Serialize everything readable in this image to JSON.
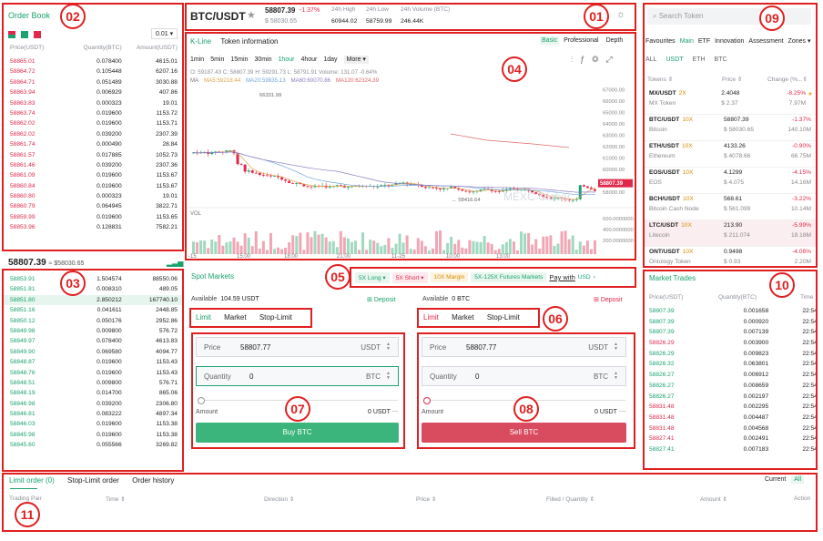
{
  "header": {
    "pair": "BTC/USDT",
    "price": "58807.39",
    "change": "-1.37%",
    "sub_price": "$ 58030.65",
    "stats": [
      {
        "label": "24h High",
        "value": "60944.02"
      },
      {
        "label": "24h Low",
        "value": "58759.99"
      },
      {
        "label": "24h Volume (BTC)",
        "value": "246.44K"
      }
    ]
  },
  "order_book": {
    "title": "Order Book",
    "precision": "0.01",
    "columns": [
      "Price(USDT)",
      "Quantity(BTC)",
      "Amount(USDT)"
    ],
    "asks": [
      [
        "58865.01",
        "0.078400",
        "4615.01"
      ],
      [
        "58864.72",
        "0.105448",
        "6207.16"
      ],
      [
        "58864.71",
        "0.051489",
        "3030.88"
      ],
      [
        "58863.94",
        "0.006929",
        "407.86"
      ],
      [
        "58863.83",
        "0.000323",
        "19.01"
      ],
      [
        "58863.74",
        "0.019600",
        "1153.72"
      ],
      [
        "58862.02",
        "0.019600",
        "1153.71"
      ],
      [
        "58862.02",
        "0.039200",
        "2307.39"
      ],
      [
        "58861.74",
        "0.000490",
        "28.84"
      ],
      [
        "58861.57",
        "0.017885",
        "1052.73"
      ],
      [
        "58861.46",
        "0.039200",
        "2307.36"
      ],
      [
        "58861.09",
        "0.019600",
        "1153.67"
      ],
      [
        "58860.84",
        "0.019600",
        "1153.67"
      ],
      [
        "58860.80",
        "0.000323",
        "19.01"
      ],
      [
        "58860.79",
        "0.064945",
        "3822.71"
      ],
      [
        "58859.99",
        "0.019600",
        "1153.65"
      ],
      [
        "58853.96",
        "0.128831",
        "7582.21"
      ]
    ],
    "last_price": "58807.39",
    "last_usd": "≈ $58030.65",
    "bids": [
      [
        "58853.91",
        "1.504574",
        "88550.06"
      ],
      [
        "58851.81",
        "0.008310",
        "489.05"
      ],
      [
        "58851.80",
        "2.850212",
        "167740.10"
      ],
      [
        "58851.16",
        "0.041611",
        "2448.85"
      ],
      [
        "58850.12",
        "0.050176",
        "2952.86"
      ],
      [
        "58849.98",
        "0.009800",
        "576.72"
      ],
      [
        "58849.97",
        "0.078400",
        "4613.83"
      ],
      [
        "58849.90",
        "0.069580",
        "4094.77"
      ],
      [
        "58848.87",
        "0.019600",
        "1153.43"
      ],
      [
        "58848.76",
        "0.019600",
        "1153.43"
      ],
      [
        "58848.51",
        "0.009800",
        "576.71"
      ],
      [
        "58848.19",
        "0.014700",
        "865.06"
      ],
      [
        "58846.98",
        "0.039200",
        "2306.80"
      ],
      [
        "58846.81",
        "0.083222",
        "4897.34"
      ],
      [
        "58846.03",
        "0.019600",
        "1153.38"
      ],
      [
        "58845.98",
        "0.019600",
        "1153.38"
      ],
      [
        "58845.60",
        "0.055566",
        "3269.82"
      ]
    ]
  },
  "chart": {
    "tabs": [
      "K-Line",
      "Token information"
    ],
    "views": [
      "Basic",
      "Professional",
      "Depth"
    ],
    "intervals": [
      "1min",
      "5min",
      "15min",
      "30min",
      "1hour",
      "4hour",
      "1day",
      "More ▾"
    ],
    "ohlc": "O: 59187.43  C: 58807.39  H: 59291.73  L: 58791.91  Volume: 131.07  -0.64%",
    "ma_line": [
      "MA",
      "MA5:59218.44",
      "MA20:59835.13",
      "MA60:60070.86",
      "MA120:62324.39"
    ],
    "high_mark": "66331.99",
    "low_mark": "← 58416.64",
    "watermark": "MEXC Global",
    "vol_label": "VOL",
    "last_tag": "58807.39",
    "x_labels": [
      "-15",
      "15:00",
      "18:00",
      "21:00",
      "11-25",
      "10:00",
      "13:00"
    ],
    "y_labels": [
      "67000.00",
      "66000.00",
      "65000.00",
      "64000.00",
      "63000.00",
      "62000.00",
      "61000.00",
      "60000.00",
      "59000.00",
      "58000.00"
    ],
    "vol_y": [
      "600.0000000",
      "400.0000000",
      "200.0000000"
    ]
  },
  "chart_data": {
    "type": "candlestick",
    "title": "",
    "xlabel": "",
    "ylabel": "",
    "ylim": [
      57500,
      67500
    ],
    "last": 58807.39,
    "high": 66331.99,
    "low": 58416.64
  },
  "leverage_bar": {
    "items": [
      "5X Long ▾",
      "5X Short ▾",
      "10X Margin",
      "5X-125X Futures Markets"
    ],
    "more": "Pay with",
    "more2": "USD"
  },
  "spot": {
    "title": "Spot Markets",
    "buy": {
      "available_label": "Available",
      "available": "104.59 USDT",
      "deposit": "Deposit",
      "tabs": [
        "Limit",
        "Market",
        "Stop-Limit"
      ],
      "price_label": "Price",
      "price": "58807.77",
      "price_unit": "USDT",
      "qty_label": "Quantity",
      "qty": "0",
      "qty_unit": "BTC",
      "amount_label": "Amount",
      "amount": "0 USDT",
      "amount_dash": "---",
      "button": "Buy BTC"
    },
    "sell": {
      "available_label": "Available",
      "available": "0 BTC",
      "deposit": "Deposit",
      "tabs": [
        "Limit",
        "Market",
        "Stop-Limit"
      ],
      "price_label": "Price",
      "price": "58807.77",
      "price_unit": "USDT",
      "qty_label": "Quantity",
      "qty": "0",
      "qty_unit": "BTC",
      "amount_label": "Amount",
      "amount": "0 USDT",
      "amount_dash": "---",
      "button": "Sell BTC"
    }
  },
  "markets": {
    "search_placeholder": "Search Token",
    "tabs": [
      "Favourites",
      "Main",
      "ETF",
      "Innovation",
      "Assessment",
      "Zones ▾"
    ],
    "subtabs": [
      "ALL",
      "USDT",
      "ETH",
      "BTC"
    ],
    "columns": [
      "Tokens ⇕",
      "Price ⇕",
      "Change (%...⇕"
    ],
    "rows": [
      {
        "pair": "MX/USDT",
        "lev": "2X",
        "name": "MX Token",
        "price": "2.4048",
        "usd": "$ 2.37",
        "change": "-8.25%",
        "vol": "7.97M"
      },
      {
        "pair": "BTC/USDT",
        "lev": "10X",
        "name": "Bitcoin",
        "price": "58807.39",
        "usd": "$ 58030.65",
        "change": "-1.37%",
        "vol": "140.10M"
      },
      {
        "pair": "ETH/USDT",
        "lev": "10X",
        "name": "Ethereum",
        "price": "4133.26",
        "usd": "$ 4078.66",
        "change": "-0.90%",
        "vol": "66.75M"
      },
      {
        "pair": "EOS/USDT",
        "lev": "10X",
        "name": "EOS",
        "price": "4.1299",
        "usd": "$ 4.075",
        "change": "-4.15%",
        "vol": "14.16M"
      },
      {
        "pair": "BCH/USDT",
        "lev": "10X",
        "name": "Bitcoin Cash Node",
        "price": "568.61",
        "usd": "$ 561.099",
        "change": "-3.22%",
        "vol": "10.14M"
      },
      {
        "pair": "LTC/USDT",
        "lev": "10X",
        "name": "Litecoin",
        "price": "213.90",
        "usd": "$ 211.074",
        "change": "-5.99%",
        "vol": "18.18M"
      },
      {
        "pair": "ONT/USDT",
        "lev": "10X",
        "name": "Ontology Token",
        "price": "0.9498",
        "usd": "$ 0.93",
        "change": "-4.06%",
        "vol": "2.20M"
      }
    ]
  },
  "market_trades": {
    "title": "Market Trades",
    "columns": [
      "Price(USDT)",
      "Quantity(BTC)",
      "Time"
    ],
    "rows": [
      [
        "58807.39",
        "0.001658",
        "22:54:56",
        "g"
      ],
      [
        "58807.39",
        "0.000920",
        "22:54:56",
        "g"
      ],
      [
        "58807.39",
        "0.007139",
        "22:54:56",
        "g"
      ],
      [
        "58826.29",
        "0.003900",
        "22:54:51",
        "r"
      ],
      [
        "58826.29",
        "0.009823",
        "22:54:51",
        "g"
      ],
      [
        "58826.32",
        "0.063801",
        "22:54:50",
        "g"
      ],
      [
        "58826.27",
        "0.006912",
        "22:54:56",
        "g"
      ],
      [
        "58826.27",
        "0.008659",
        "22:54:56",
        "g"
      ],
      [
        "58826.27",
        "0.002197",
        "22:54:56",
        "g"
      ],
      [
        "58831.48",
        "0.002295",
        "22:54:47",
        "r"
      ],
      [
        "58831.48",
        "0.004487",
        "22:54:47",
        "r"
      ],
      [
        "58831.48",
        "0.004568",
        "22:54:47",
        "r"
      ],
      [
        "58827.41",
        "0.002491",
        "22:54:45",
        "r"
      ],
      [
        "58827.41",
        "0.007183",
        "22:54:45",
        "g"
      ]
    ]
  },
  "orders": {
    "tabs": [
      "Limit order (0)",
      "Stop-Limit order",
      "Order history"
    ],
    "current": "Current",
    "all": "All",
    "columns": [
      "Trading Pair",
      "Time ⇕",
      "Direction ⇕",
      "Price ⇕",
      "Filled / Quantity ⇕",
      "Amount ⇕",
      "Action"
    ]
  },
  "badges": [
    "01",
    "02",
    "03",
    "04",
    "05",
    "06",
    "07",
    "08",
    "09",
    "10",
    "11"
  ]
}
